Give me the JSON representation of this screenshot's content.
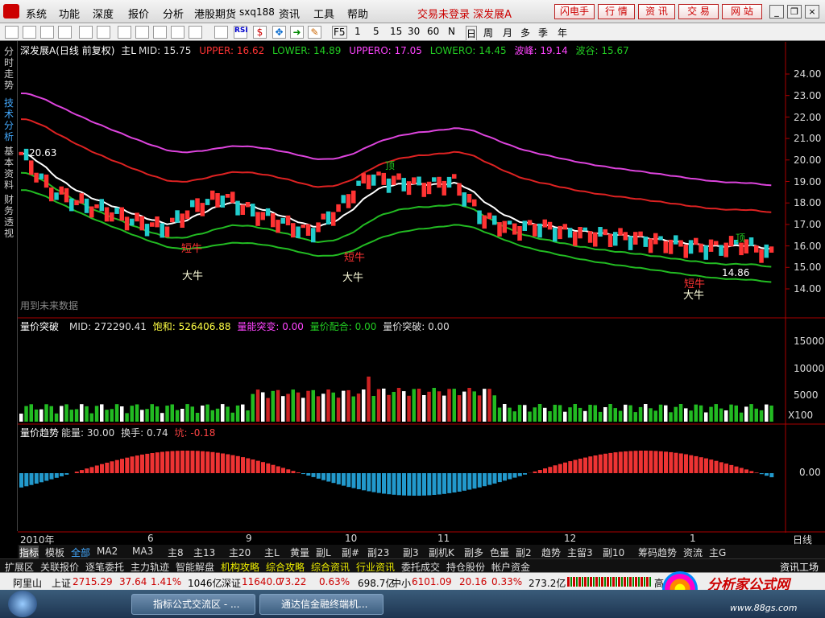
{
  "menubar": {
    "items": [
      "系统",
      "功能",
      "深度",
      "报价",
      "分析",
      "港股期货",
      "sxq188",
      "资讯",
      "工具",
      "帮助"
    ],
    "status": "交易未登录 深发展A",
    "buttons": [
      "闪电手",
      "行 情",
      "资 讯",
      "交 易",
      "网 站"
    ]
  },
  "toolbar": {
    "items": [
      "F5",
      "1",
      "5",
      "15",
      "30",
      "60",
      "N",
      "日",
      "周",
      "月",
      "多",
      "季",
      "年"
    ]
  },
  "side_tabs": [
    "分时走势",
    "技术分析",
    "基本资料",
    "财务透视"
  ],
  "main_panel": {
    "title": "深发展A",
    "period": "(日线 前复权)",
    "main_label": "主L",
    "indicators": [
      {
        "name": "MID",
        "value": "15.75",
        "color": "#dddddd"
      },
      {
        "name": "UPPER",
        "value": "16.62",
        "color": "#ff3333"
      },
      {
        "name": "LOWER",
        "value": "14.89",
        "color": "#22cc22"
      },
      {
        "name": "UPPERO",
        "value": "17.05",
        "color": "#ff44ff"
      },
      {
        "name": "LOWERO",
        "value": "14.45",
        "color": "#22cc22"
      },
      {
        "name": "波峰",
        "value": "19.14",
        "color": "#ff44ff"
      },
      {
        "name": "波谷",
        "value": "15.67",
        "color": "#22cc22"
      }
    ],
    "y_ticks": [
      "24.00",
      "23.00",
      "22.00",
      "21.00",
      "20.00",
      "19.00",
      "18.00",
      "17.00",
      "16.00",
      "15.00",
      "14.00"
    ],
    "price_labels": {
      "high": "20.63",
      "low": "14.86"
    },
    "signals": {
      "short_bull": "短牛",
      "big_bull": "大牛",
      "top": "顶"
    },
    "note": "用到未来数据"
  },
  "vol_panel": {
    "title": "量价突破",
    "indicators": [
      {
        "name": "MID",
        "value": "272290.41",
        "color": "#dddddd"
      },
      {
        "name": "饱和",
        "value": "526406.88",
        "color": "#ffff44"
      },
      {
        "name": "量能突变",
        "value": "0.00",
        "color": "#ff44ff"
      },
      {
        "name": "量价配合",
        "value": "0.00",
        "color": "#22cc22"
      },
      {
        "name": "量价突破",
        "value": "0.00",
        "color": "#dddddd"
      }
    ],
    "y_ticks": [
      "15000",
      "10000",
      "5000",
      "X100"
    ]
  },
  "trend_panel": {
    "title": "量价趋势",
    "indicators": [
      {
        "name": "能量",
        "value": "30.00",
        "color": "#dddddd"
      },
      {
        "name": "换手",
        "value": "0.74",
        "color": "#dddddd"
      },
      {
        "name": "坑",
        "value": "-0.18",
        "color": "#ff4444"
      }
    ],
    "y_ticks": [
      "0.00"
    ]
  },
  "x_axis": {
    "labels": [
      "2010年",
      "6",
      "9",
      "10",
      "11",
      "12",
      "1"
    ],
    "mode": "日线"
  },
  "bottom_tabs": [
    "指标",
    "模板",
    "全部",
    "MA2",
    "MA3",
    "主8",
    "主13",
    "主20",
    "主L",
    "黄量",
    "副L",
    "副#",
    "副23",
    "副3",
    "副机K",
    "副多",
    "色量",
    "副2",
    "趋势",
    "主留3",
    "副10",
    "筹码趋势",
    "资流",
    "主G"
  ],
  "bottom_tabs2": [
    "扩展区",
    "关联报价",
    "逐笔委托",
    "主力轨迹",
    "智能解盘",
    "机构攻略",
    "综合攻略",
    "综合资讯",
    "行业资讯",
    "委托成交",
    "持仓股份",
    "帐户资金"
  ],
  "bottom_tabs2_right": "资讯工场",
  "status": {
    "stock": "阿里山",
    "indexes": [
      {
        "name": "上证",
        "value": "2715.29",
        "chg": "37.64",
        "pct": "1.41%",
        "amt": "1046亿"
      },
      {
        "name": "深证",
        "value": "11640.0",
        "chg": "73.22",
        "pct": "0.63%",
        "amt": "698.7亿"
      },
      {
        "name": "中小",
        "value": "6101.09",
        "chg": "20.16",
        "pct": "0.33%",
        "amt": "273.2亿"
      }
    ],
    "trailing": "高 ... 北..."
  },
  "watermark": {
    "line1": "分析家公式网",
    "line2": "www.88gs.com"
  },
  "taskbar": {
    "tasks": [
      "指标公式交流区 - ...",
      "通达信金融终端机..."
    ]
  },
  "colors": {
    "up": "#ff3333",
    "down": "#22cccc",
    "ma": "#ffffff",
    "upper": "#dd2222",
    "upper_o": "#dd44dd",
    "lower": "#22bb22"
  }
}
